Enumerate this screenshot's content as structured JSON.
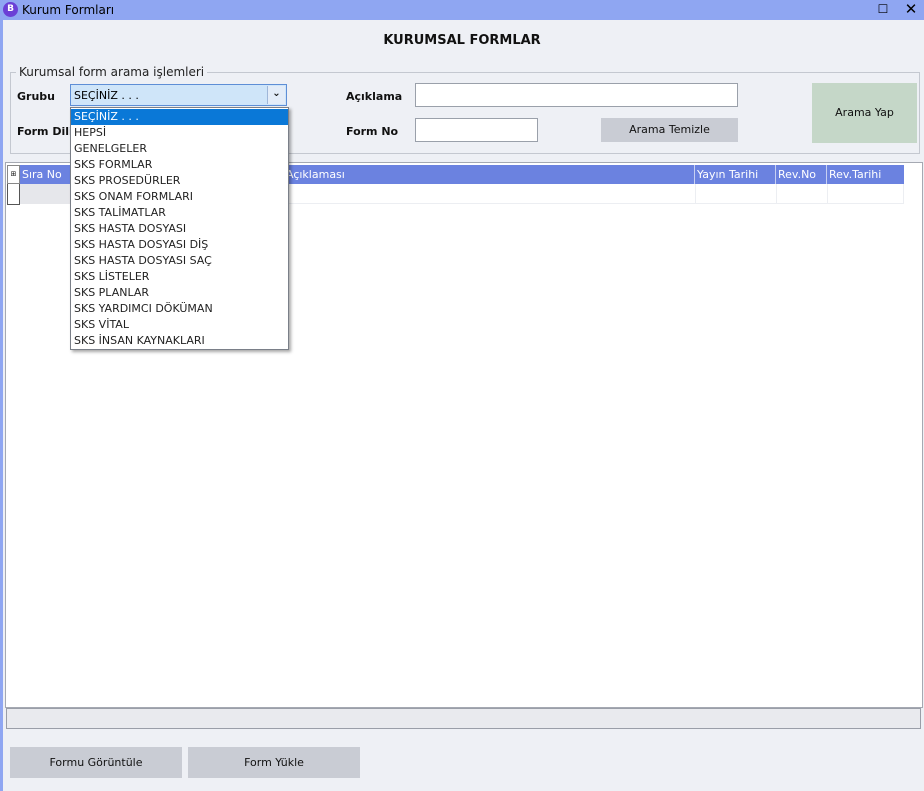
{
  "window": {
    "title": "Kurum Formları",
    "app_icon_letter": "B",
    "maximize_glyph": "☐",
    "close_glyph": "✕"
  },
  "page_title": "KURUMSAL FORMLAR",
  "search": {
    "legend": "Kurumsal form arama işlemleri",
    "grubu_label": "Grubu",
    "grubu_value": "SEÇİNİZ . . .",
    "form_dili_label": "Form Dili",
    "aciklama_label": "Açıklama",
    "aciklama_value": "",
    "form_no_label": "Form No",
    "form_no_value": "",
    "search_button": "Arama Yap",
    "clear_button": "Arama Temizle"
  },
  "grubu_options": [
    "SEÇİNİZ . . .",
    "HEPSİ",
    "GENELGELER",
    "SKS FORMLAR",
    "SKS PROSEDÜRLER",
    "SKS ONAM FORMLARI",
    "SKS TALİMATLAR",
    "SKS HASTA DOSYASI",
    "SKS HASTA DOSYASI DİŞ",
    "SKS HASTA DOSYASI SAÇ",
    "SKS LİSTELER",
    "SKS PLANLAR",
    "SKS YARDIMCI DÖKÜMAN",
    "SKS VİTAL",
    "SKS İNSAN KAYNAKLARI"
  ],
  "grubu_selected_index": 0,
  "grid": {
    "columns": [
      "Sıra No",
      "Açıklaması",
      "Yayın Tarihi",
      "Rev.No",
      "Rev.Tarihi"
    ]
  },
  "footer": {
    "view_button": "Formu Görüntüle",
    "upload_button": "Form Yükle"
  },
  "colors": {
    "titlebar": "#8fa6f2",
    "grid_header": "#6b82e0",
    "dropdown_selected": "#0a78d7"
  }
}
